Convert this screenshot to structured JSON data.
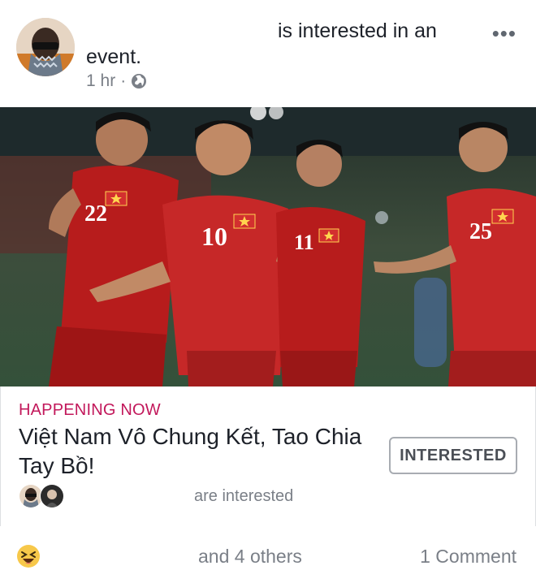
{
  "post": {
    "action_text": "is interested in an",
    "action_text_2": "event.",
    "time": "1 hr",
    "separator": "·",
    "privacy_icon": "globe-icon",
    "menu_icon": "more-dots-icon",
    "menu_label": "•••"
  },
  "event": {
    "status": "HAPPENING NOW",
    "title": "Việt Nam Vô Chung Kết, Tao Chia Tay Bồ!",
    "interested_button": "INTERESTED",
    "interested_text": "are interested",
    "jersey_numbers": [
      "22",
      "10",
      "11",
      "25"
    ]
  },
  "footer": {
    "reaction_icon": "haha-emoji-icon",
    "reactions_text": "and 4 others",
    "comments_text": "1 Comment"
  },
  "colors": {
    "status": "#c2185b",
    "jersey": "#b71c1c",
    "text_primary": "#1d2129",
    "text_secondary": "#7a7f87"
  }
}
